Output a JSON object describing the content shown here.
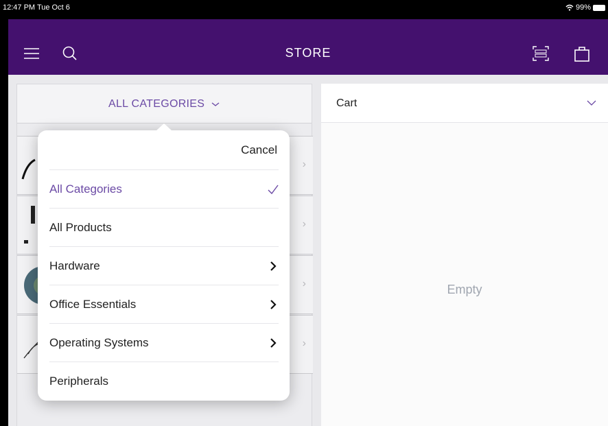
{
  "status_bar": {
    "time": "12:47 PM  Tue Oct 6",
    "battery": "99%"
  },
  "header": {
    "title": "STORE"
  },
  "categories": {
    "selector_label": "ALL CATEGORIES"
  },
  "cart": {
    "label": "Cart",
    "empty_text": "Empty"
  },
  "popover": {
    "cancel_label": "Cancel",
    "items": [
      {
        "label": "All Categories",
        "selected": true
      },
      {
        "label": "All Products"
      },
      {
        "label": "Hardware",
        "has_submenu": true
      },
      {
        "label": "Office Essentials",
        "has_submenu": true
      },
      {
        "label": "Operating Systems",
        "has_submenu": true
      },
      {
        "label": "Peripherals"
      }
    ]
  },
  "colors": {
    "brand_purple": "#44116e",
    "accent": "#6b4aa5",
    "empty_text": "#a0a6b0"
  }
}
